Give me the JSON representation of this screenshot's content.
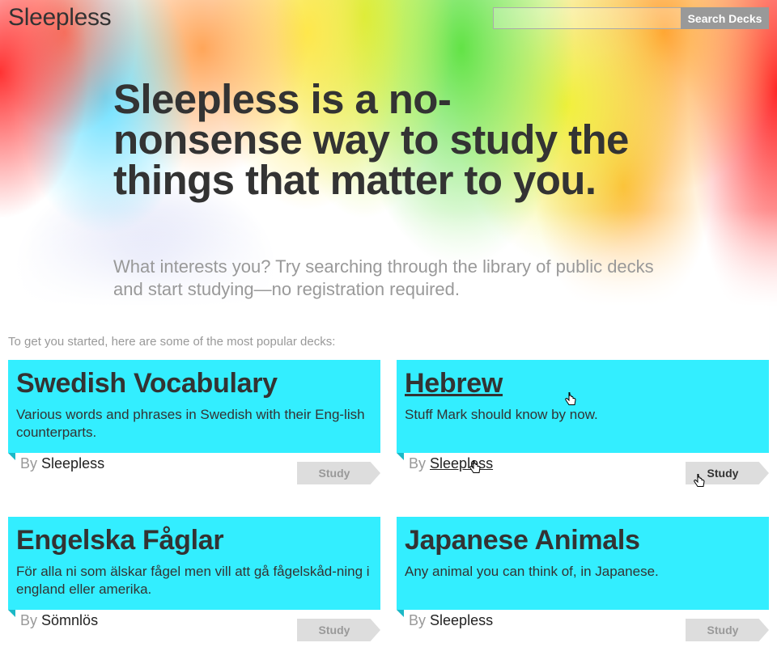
{
  "app": {
    "logo": "Sleepless"
  },
  "search": {
    "placeholder": "",
    "button_label": "Search Decks"
  },
  "hero": {
    "headline": "Sleepless is a no-nonsense way to study the things that matter to you.",
    "subline": "What interests you? Try searching through the library of public decks and start studying—no registration required."
  },
  "decks_intro": "To get you started, here are some of the most popular decks:",
  "decks": [
    {
      "title": "Swedish Vocabulary",
      "description": "Various words and phrases in Swedish with their Eng-lish counterparts.",
      "by_label": "By",
      "author": "Sleepless",
      "study_label": "Study"
    },
    {
      "title": "Hebrew",
      "description": "Stuff Mark should know by now.",
      "by_label": "By",
      "author": "Sleepless",
      "study_label": "Study"
    },
    {
      "title": "Engelska Fåglar",
      "description": "För alla ni som älskar fågel men vill att gå fågelskåd-ning i england eller amerika.",
      "by_label": "By",
      "author": "Sömnlös",
      "study_label": "Study"
    },
    {
      "title": "Japanese Animals",
      "description": "Any animal you can think of, in Japanese.",
      "by_label": "By",
      "author": "Sleepless",
      "study_label": "Study"
    }
  ],
  "colors": {
    "card": "#33eeff",
    "card_fold": "#1bb8c6",
    "study_button": "#dddddd",
    "search_button": "#999999",
    "text": "#333333",
    "muted": "#999999"
  }
}
